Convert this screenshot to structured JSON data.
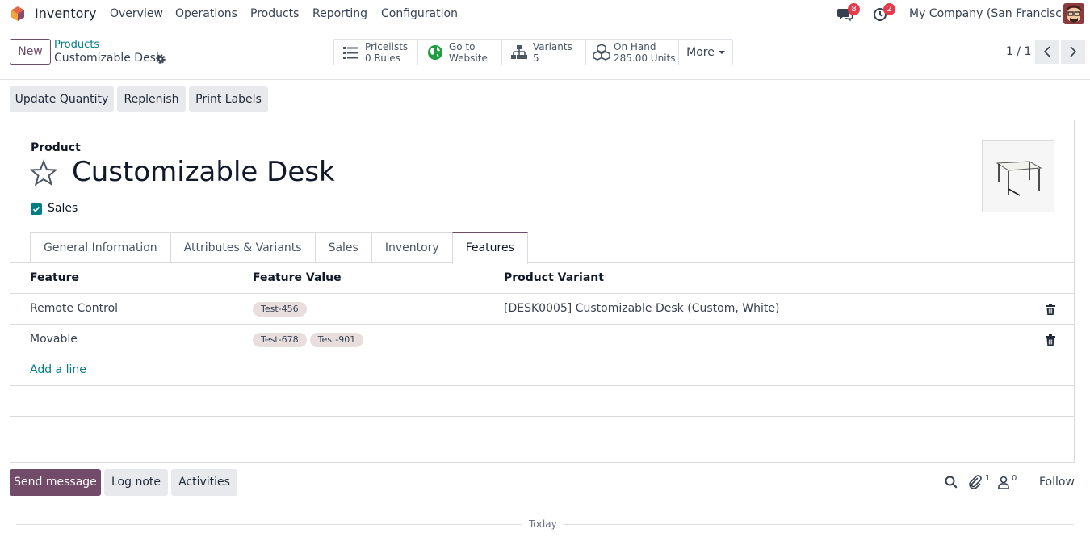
{
  "navbar": {
    "app_name": "Inventory",
    "menu": [
      "Overview",
      "Operations",
      "Products",
      "Reporting",
      "Configuration"
    ],
    "messages_badge": "8",
    "activities_badge": "2",
    "company": "My Company (San Francisco)",
    "brand_color": "#714b67"
  },
  "control_panel": {
    "new_label": "New",
    "breadcrumb_parent": "Products",
    "breadcrumb_current": "Customizable Desk",
    "smart_buttons": [
      {
        "label": "Pricelists",
        "value": "0 Rules",
        "icon": "list-icon"
      },
      {
        "label": "Go to",
        "value": "Website",
        "icon": "globe-icon"
      },
      {
        "label": "Variants",
        "value": "5",
        "icon": "sitemap-icon"
      },
      {
        "label": "On Hand",
        "value": "285.00 Units",
        "icon": "cubes-icon"
      }
    ],
    "more_label": "More",
    "pager": "1 / 1"
  },
  "actions": {
    "update_quantity": "Update Quantity",
    "replenish": "Replenish",
    "print_labels": "Print Labels"
  },
  "form": {
    "product_label": "Product",
    "product_name": "Customizable Desk",
    "sales_label": "Sales",
    "sales_checked": true,
    "tabs": [
      "General Information",
      "Attributes & Variants",
      "Sales",
      "Inventory",
      "Features"
    ],
    "active_tab": "Features"
  },
  "table": {
    "columns": [
      "Feature",
      "Feature Value",
      "Product Variant"
    ],
    "rows": [
      {
        "feature": "Remote Control",
        "values": [
          "Test-456"
        ],
        "variant": "[DESK0005] Customizable Desk (Custom, White)"
      },
      {
        "feature": "Movable",
        "values": [
          "Test-678",
          "Test-901"
        ],
        "variant": ""
      }
    ],
    "add_line": "Add a line"
  },
  "chatter": {
    "send_message": "Send message",
    "log_note": "Log note",
    "activities": "Activities",
    "attachments_count": "1",
    "followers_count": "0",
    "follow": "Follow",
    "today": "Today"
  }
}
